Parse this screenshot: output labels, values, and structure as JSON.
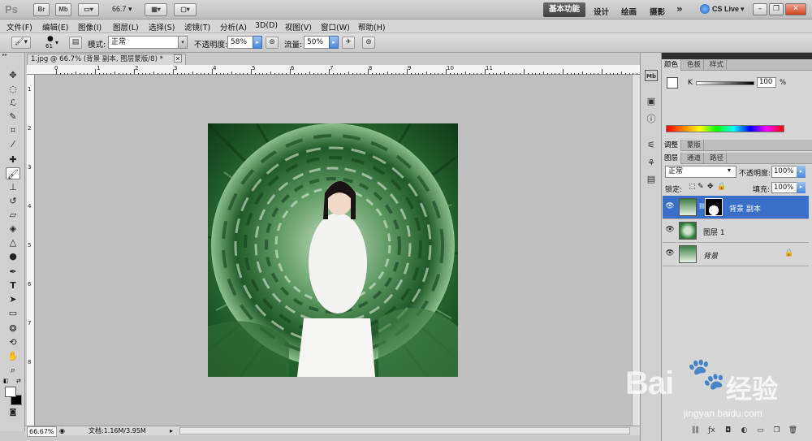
{
  "appbar": {
    "logo": "Ps",
    "br": "Br",
    "mb": "Mb",
    "zoom": "66.7",
    "workspace_active": "基本功能",
    "workspaces": [
      "设计",
      "绘画",
      "摄影"
    ],
    "more": "»",
    "cs_live": "CS Live"
  },
  "menu": [
    "文件(F)",
    "编辑(E)",
    "图像(I)",
    "图层(L)",
    "选择(S)",
    "滤镜(T)",
    "分析(A)",
    "3D(D)",
    "视图(V)",
    "窗口(W)",
    "帮助(H)"
  ],
  "options": {
    "brush_size": "61",
    "mode_label": "模式:",
    "mode_value": "正常",
    "opacity_label": "不透明度:",
    "opacity_value": "58%",
    "flow_label": "流量:",
    "flow_value": "50%"
  },
  "document": {
    "tab_title": "1.jpg @ 66.7% (背景 副本, 图层蒙版/8) *",
    "ruler_top": [
      "0",
      "1",
      "2",
      "3",
      "4",
      "5",
      "6",
      "7",
      "8",
      "9",
      "10",
      "11"
    ],
    "ruler_left": [
      "1",
      "2",
      "3",
      "4",
      "5",
      "6",
      "7",
      "8"
    ],
    "zoom_status": "66.67%",
    "doc_status": "文档:1.16M/3.95M"
  },
  "color_panel": {
    "tabs": [
      "颜色",
      "色板",
      "样式"
    ],
    "channel": "K",
    "value": "100",
    "unit": "%"
  },
  "adjust_panel": {
    "tabs": [
      "调整",
      "蒙版"
    ]
  },
  "layers_panel": {
    "tabs": [
      "图层",
      "通道",
      "路径"
    ],
    "blend_mode": "正常",
    "opacity_label": "不透明度:",
    "opacity_value": "100%",
    "lock_label": "锁定:",
    "fill_label": "填充:",
    "fill_value": "100%",
    "layers": [
      {
        "name": "背景 副本",
        "selected": true
      },
      {
        "name": "图层 1",
        "selected": false
      },
      {
        "name": "背景",
        "selected": false
      }
    ]
  },
  "watermark": {
    "brand": "Bai",
    "brand2": "经验",
    "url": "jingyan.baidu.com"
  },
  "colors": {
    "selection": "#3a6fc9",
    "canvas_bg": "#c0c0c0",
    "photo_green": "#2f7a3a"
  }
}
